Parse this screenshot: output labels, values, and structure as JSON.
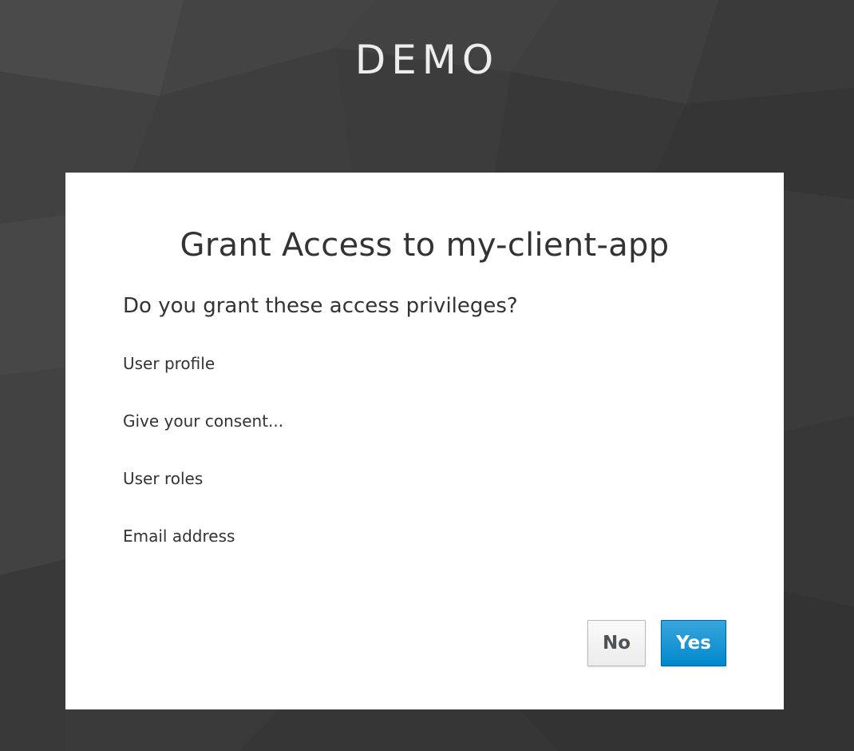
{
  "realm": {
    "title": "DEMO"
  },
  "consent": {
    "title": "Grant Access to my-client-app",
    "question": "Do you grant these access privileges?",
    "scopes": [
      "User profile",
      "Give your consent...",
      "User roles",
      "Email address"
    ],
    "buttons": {
      "no_label": "No",
      "yes_label": "Yes"
    }
  },
  "colors": {
    "background": "#3a3a3a",
    "card": "#ffffff",
    "primary": "#0088ce",
    "text": "#333333"
  }
}
